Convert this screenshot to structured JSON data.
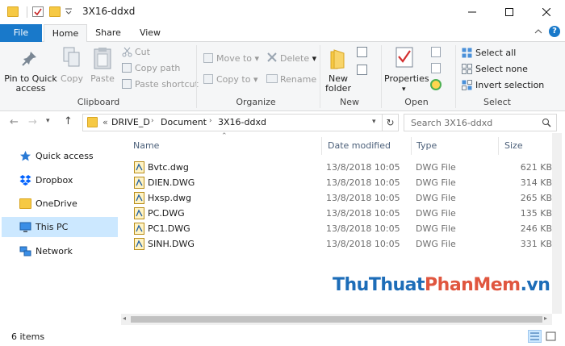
{
  "window": {
    "title": "3X16-ddxd",
    "minimize_icon": "minimize-icon",
    "maximize_icon": "maximize-icon",
    "close_icon": "close-icon"
  },
  "tabs": [
    {
      "label": "File"
    },
    {
      "label": "Home"
    },
    {
      "label": "Share"
    },
    {
      "label": "View"
    }
  ],
  "ribbon": {
    "clipboard": {
      "pin": "Pin to Quick access",
      "copy": "Copy",
      "paste": "Paste",
      "cut": "Cut",
      "copy_path": "Copy path",
      "paste_shortcut": "Paste shortcut",
      "group": "Clipboard"
    },
    "organize": {
      "move_to": "Move to",
      "copy_to": "Copy to",
      "delete": "Delete",
      "rename": "Rename",
      "group": "Organize"
    },
    "new": {
      "new_folder": "New folder",
      "group": "New"
    },
    "open": {
      "properties": "Properties",
      "group": "Open"
    },
    "select": {
      "select_all": "Select all",
      "select_none": "Select none",
      "invert": "Invert selection",
      "group": "Select"
    }
  },
  "address": {
    "prefix": "«",
    "crumbs": [
      "DRIVE_D",
      "Document",
      "3X16-ddxd"
    ],
    "search_placeholder": "Search 3X16-ddxd"
  },
  "nav_pane": [
    {
      "label": "Quick access",
      "icon": "star-icon"
    },
    {
      "label": "Dropbox",
      "icon": "dropbox-icon"
    },
    {
      "label": "OneDrive",
      "icon": "onedrive-folder-icon"
    },
    {
      "label": "This PC",
      "icon": "monitor-icon",
      "selected": true
    },
    {
      "label": "Network",
      "icon": "network-icon"
    }
  ],
  "columns": {
    "name": "Name",
    "date": "Date modified",
    "type": "Type",
    "size": "Size"
  },
  "files": [
    {
      "name": "Bvtc.dwg",
      "date": "13/8/2018 10:05",
      "type": "DWG File",
      "size": "621 KB"
    },
    {
      "name": "DIEN.DWG",
      "date": "13/8/2018 10:05",
      "type": "DWG File",
      "size": "314 KB"
    },
    {
      "name": "Hxsp.dwg",
      "date": "13/8/2018 10:05",
      "type": "DWG File",
      "size": "265 KB"
    },
    {
      "name": "PC.DWG",
      "date": "13/8/2018 10:05",
      "type": "DWG File",
      "size": "135 KB"
    },
    {
      "name": "PC1.DWG",
      "date": "13/8/2018 10:05",
      "type": "DWG File",
      "size": "246 KB"
    },
    {
      "name": "SINH.DWG",
      "date": "13/8/2018 10:05",
      "type": "DWG File",
      "size": "331 KB"
    }
  ],
  "status": {
    "count": "6 items"
  },
  "watermark": {
    "part1": "ThuThuat",
    "part2": "PhanMem",
    "part3": ".vn"
  },
  "colors": {
    "accent": "#1979ca",
    "selection": "#cce8ff",
    "folder": "#f6c944"
  }
}
